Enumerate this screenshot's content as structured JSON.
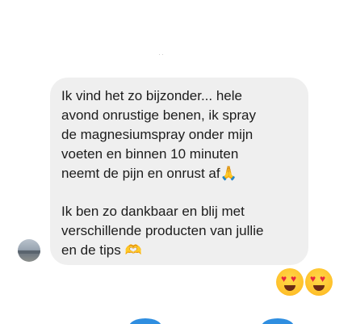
{
  "header": {
    "timestamp": "··"
  },
  "message": {
    "lines": [
      "Ik vind het zo bijzonder... hele",
      "avond onrustige benen, ik spray",
      "de magnesiumspray onder mijn",
      "voeten en binnen 10 minuten",
      "neemt de pijn en onrust af🙏",
      "Ik ben zo dankbaar en blij met",
      "verschillende producten van jullie",
      "en de tips 🫶"
    ]
  },
  "reactions": {
    "emojis": [
      "heart-eyes-emoji",
      "heart-eyes-emoji"
    ]
  },
  "colors": {
    "bubble": "#efefef",
    "text": "#1c1c1c",
    "accent": "#2f8ee0"
  }
}
